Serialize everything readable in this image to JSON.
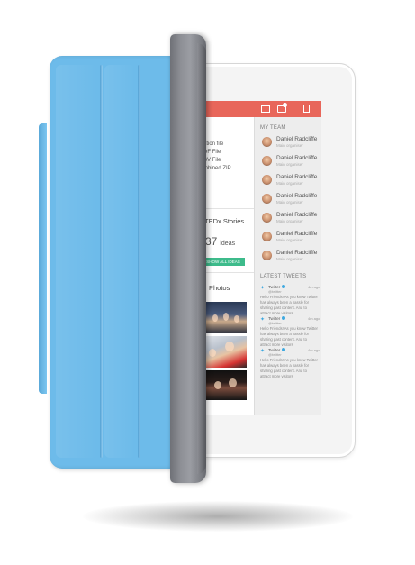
{
  "main": {
    "files": [
      {
        "label": "ation file"
      },
      {
        "label": "DF File"
      },
      {
        "label": "SV File"
      },
      {
        "label": "mbined ZIP"
      }
    ],
    "stories": {
      "title": "TEDx Stories",
      "count": "37",
      "count_label": "ideas",
      "show_all_label": "SHOW ALL IDEAS"
    },
    "photos": {
      "title": "Photos"
    }
  },
  "sidebar": {
    "team_title": "MY TEAM",
    "team": [
      {
        "name": "Daniel Radcliffe",
        "role": "Main organiser"
      },
      {
        "name": "Daniel Radcliffe",
        "role": "Main organiser"
      },
      {
        "name": "Daniel Radcliffe",
        "role": "Main organiser"
      },
      {
        "name": "Daniel Radcliffe",
        "role": "Main organiser"
      },
      {
        "name": "Daniel Radcliffe",
        "role": "Main organiser"
      },
      {
        "name": "Daniel Radcliffe",
        "role": "Main organiser"
      },
      {
        "name": "Daniel Radcliffe",
        "role": "Main organiser"
      }
    ],
    "tweets_title": "LATEST TWEETS",
    "tweets": [
      {
        "name": "Twitter",
        "handle": "@twitter",
        "time": "4m ago",
        "text": "Hello Friends! As you know Twitter has always been a hassle for sharing past content. And to attract more visitors"
      },
      {
        "name": "Twitter",
        "handle": "@twitter",
        "time": "4m ago",
        "text": "Hello Friends! As you know Twitter has always been a hassle for sharing past content. And to attract more visitors"
      },
      {
        "name": "Twitter",
        "handle": "@twitter",
        "time": "4m ago",
        "text": "Hello Friends! As you know Twitter has always been a hassle for sharing past content. And to attract more visitors"
      }
    ]
  },
  "colors": {
    "topbar": "#e8665a",
    "accent_green": "#3dbb8b",
    "cover_blue": "#6dbbea",
    "hinge_gray": "#8e9096",
    "twitter_blue": "#3fa9e0"
  },
  "icons": {
    "topbar": [
      "grid-icon",
      "mail-icon",
      "logout-icon"
    ],
    "tweet": "twitter-bird-icon"
  }
}
